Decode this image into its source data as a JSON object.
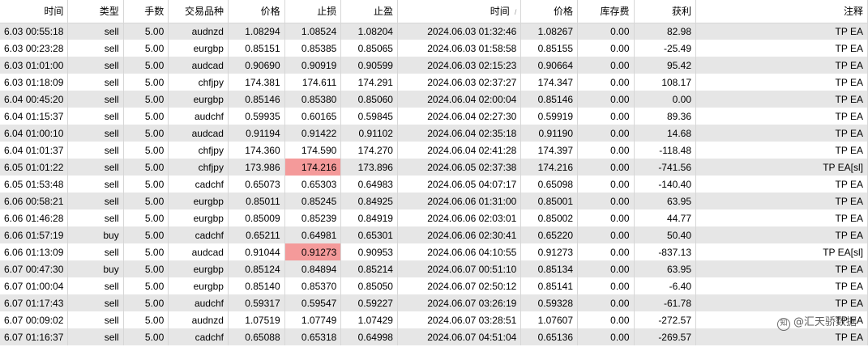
{
  "headers": [
    "时间",
    "类型",
    "手数",
    "交易品种",
    "价格",
    "止损",
    "止盈",
    "时间",
    "价格",
    "库存费",
    "获利",
    "注释"
  ],
  "sort_indicator": "/",
  "rows": [
    [
      "6.03 00:55:18",
      "sell",
      "5.00",
      "audnzd",
      "1.08294",
      "1.08524",
      "1.08204",
      "2024.06.03 01:32:46",
      "1.08267",
      "0.00",
      "82.98",
      "TP EA"
    ],
    [
      "6.03 00:23:28",
      "sell",
      "5.00",
      "eurgbp",
      "0.85151",
      "0.85385",
      "0.85065",
      "2024.06.03 01:58:58",
      "0.85155",
      "0.00",
      "-25.49",
      "TP EA"
    ],
    [
      "6.03 01:01:00",
      "sell",
      "5.00",
      "audcad",
      "0.90690",
      "0.90919",
      "0.90599",
      "2024.06.03 02:15:23",
      "0.90664",
      "0.00",
      "95.42",
      "TP EA"
    ],
    [
      "6.03 01:18:09",
      "sell",
      "5.00",
      "chfjpy",
      "174.381",
      "174.611",
      "174.291",
      "2024.06.03 02:37:27",
      "174.347",
      "0.00",
      "108.17",
      "TP EA"
    ],
    [
      "6.04 00:45:20",
      "sell",
      "5.00",
      "eurgbp",
      "0.85146",
      "0.85380",
      "0.85060",
      "2024.06.04 02:00:04",
      "0.85146",
      "0.00",
      "0.00",
      "TP EA"
    ],
    [
      "6.04 01:15:37",
      "sell",
      "5.00",
      "audchf",
      "0.59935",
      "0.60165",
      "0.59845",
      "2024.06.04 02:27:30",
      "0.59919",
      "0.00",
      "89.36",
      "TP EA"
    ],
    [
      "6.04 01:00:10",
      "sell",
      "5.00",
      "audcad",
      "0.91194",
      "0.91422",
      "0.91102",
      "2024.06.04 02:35:18",
      "0.91190",
      "0.00",
      "14.68",
      "TP EA"
    ],
    [
      "6.04 01:01:37",
      "sell",
      "5.00",
      "chfjpy",
      "174.360",
      "174.590",
      "174.270",
      "2024.06.04 02:41:28",
      "174.397",
      "0.00",
      "-118.48",
      "TP EA"
    ],
    [
      "6.05 01:01:22",
      "sell",
      "5.00",
      "chfjpy",
      "173.986",
      "174.216",
      "173.896",
      "2024.06.05 02:37:38",
      "174.216",
      "0.00",
      "-741.56",
      "TP EA[sl]"
    ],
    [
      "6.05 01:53:48",
      "sell",
      "5.00",
      "cadchf",
      "0.65073",
      "0.65303",
      "0.64983",
      "2024.06.05 04:07:17",
      "0.65098",
      "0.00",
      "-140.40",
      "TP EA"
    ],
    [
      "6.06 00:58:21",
      "sell",
      "5.00",
      "eurgbp",
      "0.85011",
      "0.85245",
      "0.84925",
      "2024.06.06 01:31:00",
      "0.85001",
      "0.00",
      "63.95",
      "TP EA"
    ],
    [
      "6.06 01:46:28",
      "sell",
      "5.00",
      "eurgbp",
      "0.85009",
      "0.85239",
      "0.84919",
      "2024.06.06 02:03:01",
      "0.85002",
      "0.00",
      "44.77",
      "TP EA"
    ],
    [
      "6.06 01:57:19",
      "buy",
      "5.00",
      "cadchf",
      "0.65211",
      "0.64981",
      "0.65301",
      "2024.06.06 02:30:41",
      "0.65220",
      "0.00",
      "50.40",
      "TP EA"
    ],
    [
      "6.06 01:13:09",
      "sell",
      "5.00",
      "audcad",
      "0.91044",
      "0.91273",
      "0.90953",
      "2024.06.06 04:10:55",
      "0.91273",
      "0.00",
      "-837.13",
      "TP EA[sl]"
    ],
    [
      "6.07 00:47:30",
      "buy",
      "5.00",
      "eurgbp",
      "0.85124",
      "0.84894",
      "0.85214",
      "2024.06.07 00:51:10",
      "0.85134",
      "0.00",
      "63.95",
      "TP EA"
    ],
    [
      "6.07 01:00:04",
      "sell",
      "5.00",
      "eurgbp",
      "0.85140",
      "0.85370",
      "0.85050",
      "2024.06.07 02:50:12",
      "0.85141",
      "0.00",
      "-6.40",
      "TP EA"
    ],
    [
      "6.07 01:17:43",
      "sell",
      "5.00",
      "audchf",
      "0.59317",
      "0.59547",
      "0.59227",
      "2024.06.07 03:26:19",
      "0.59328",
      "0.00",
      "-61.78",
      "TP EA"
    ],
    [
      "6.07 00:09:02",
      "sell",
      "5.00",
      "audnzd",
      "1.07519",
      "1.07749",
      "1.07429",
      "2024.06.07 03:28:51",
      "1.07607",
      "0.00",
      "-272.57",
      "TP EA"
    ],
    [
      "6.07 01:16:37",
      "sell",
      "5.00",
      "cadchf",
      "0.65088",
      "0.65318",
      "0.64998",
      "2024.06.07 04:51:04",
      "0.65136",
      "0.00",
      "-269.57",
      "TP EA"
    ]
  ],
  "highlight_cells": [
    [
      8,
      5
    ],
    [
      13,
      5
    ]
  ],
  "highlight_color": "#f49a9a",
  "watermark": {
    "icon": "zhihu-logo-icon",
    "text": "@汇天骄数据"
  }
}
